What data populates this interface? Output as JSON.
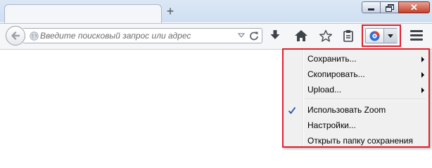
{
  "toolbar": {
    "new_tab_label": "+",
    "close_label": "✕",
    "url_placeholder": "Введите поисковый запрос или адрес"
  },
  "icons": [
    "back-arrow-icon",
    "globe-icon",
    "dropmarker-icon",
    "reload-icon",
    "download-icon",
    "home-icon",
    "bookmark-star-icon",
    "reading-list-icon",
    "extension-logo-icon",
    "menu-icon",
    "check-icon"
  ],
  "colors": {
    "highlight_border": "#e0212e",
    "titlebar": "#d4e3f4",
    "menu_background": "#f0f0f0"
  },
  "menu": {
    "items": [
      {
        "label": "Сохранить...",
        "submenu": true,
        "checked": false
      },
      {
        "label": "Скопировать...",
        "submenu": true,
        "checked": false
      },
      {
        "label": "Upload...",
        "submenu": true,
        "checked": false
      },
      {
        "label": "Использовать Zoom",
        "submenu": false,
        "checked": true
      },
      {
        "label": "Настройки...",
        "submenu": false,
        "checked": false
      },
      {
        "label": "Открыть папку сохранения",
        "submenu": false,
        "checked": false
      }
    ]
  }
}
